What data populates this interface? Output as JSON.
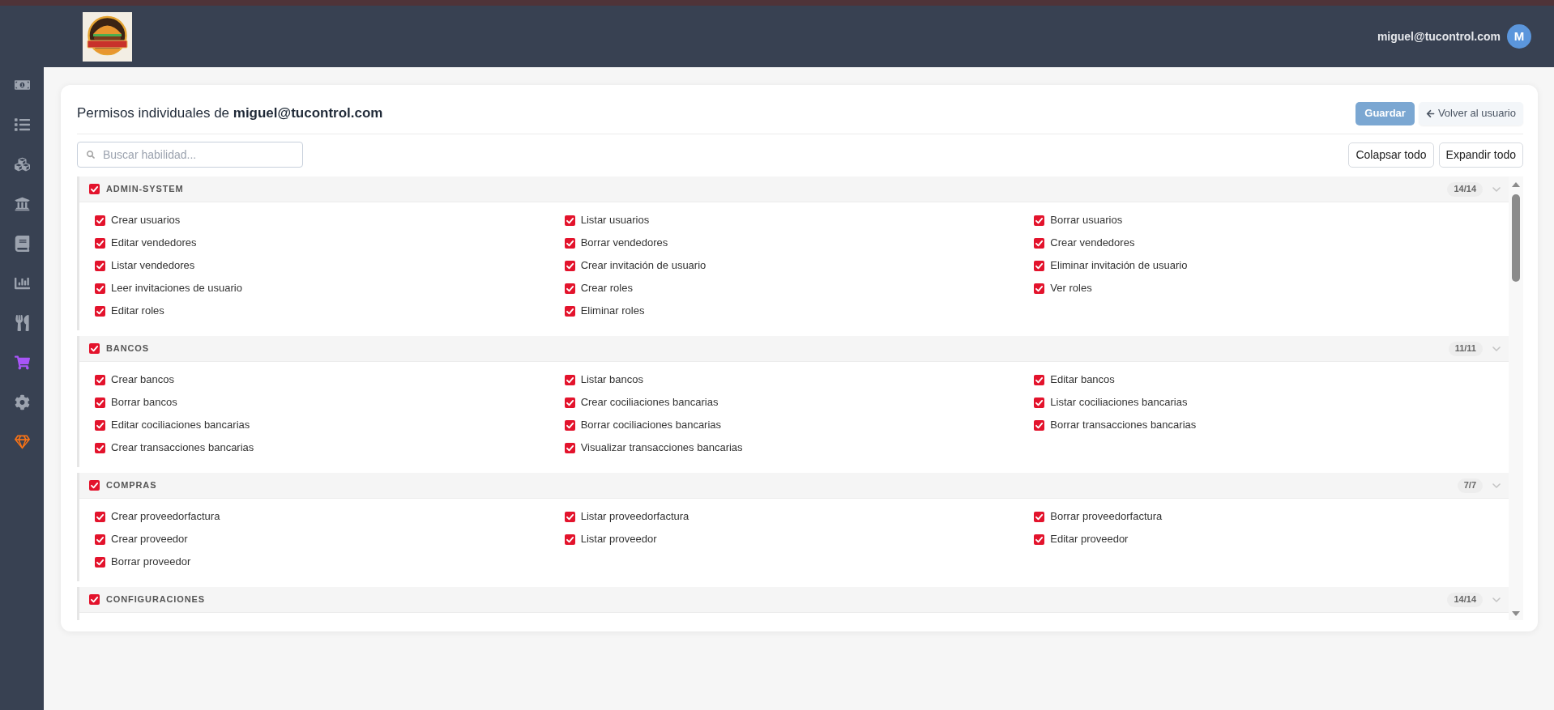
{
  "header": {
    "user": {
      "email": "miguel@tucontrol.com",
      "initial": "M"
    }
  },
  "sidebar": {
    "items": [
      {
        "kind": "nav",
        "selected": false
      },
      {
        "kind": "nav",
        "selected": false
      },
      {
        "kind": "nav",
        "selected": false
      },
      {
        "kind": "nav",
        "selected": false
      },
      {
        "kind": "nav",
        "selected": false
      },
      {
        "kind": "nav",
        "selected": false
      },
      {
        "kind": "nav",
        "selected": false
      },
      {
        "kind": "nav",
        "selected": true
      },
      {
        "kind": "nav",
        "selected": false
      },
      {
        "kind": "upgrade",
        "selected": false
      }
    ]
  },
  "page": {
    "title": "Permisos individuales de **miguel@tucontrol.com**",
    "buttons": [
      {
        "label": "Guardar",
        "kind": "primary",
        "disabled": true
      },
      {
        "label": "Volver al usuario",
        "kind": "back"
      }
    ],
    "search": {
      "placeholder": "Buscar habilidad..."
    },
    "toolbar_buttons": [
      {
        "label": "Colapsar todo"
      },
      {
        "label": "Expandir todo"
      }
    ]
  },
  "sections": [
    {
      "title": "ADMIN-SYSTEM",
      "checked": true,
      "count": "14/14",
      "expanded": true,
      "items": [
        {
          "label": "Crear usuarios",
          "checked": true
        },
        {
          "label": "Listar usuarios",
          "checked": true
        },
        {
          "label": "Borrar usuarios",
          "checked": true
        },
        {
          "label": "Editar vendedores",
          "checked": true
        },
        {
          "label": "Borrar vendedores",
          "checked": true
        },
        {
          "label": "Crear vendedores",
          "checked": true
        },
        {
          "label": "Listar vendedores",
          "checked": true
        },
        {
          "label": "Crear invitación de usuario",
          "checked": true
        },
        {
          "label": "Eliminar invitación de usuario",
          "checked": true
        },
        {
          "label": "Leer invitaciones de usuario",
          "checked": true
        },
        {
          "label": "Crear roles",
          "checked": true
        },
        {
          "label": "Ver roles",
          "checked": true
        },
        {
          "label": "Editar roles",
          "checked": true
        },
        {
          "label": "Eliminar roles",
          "checked": true
        }
      ]
    },
    {
      "title": "BANCOS",
      "checked": true,
      "count": "11/11",
      "expanded": true,
      "items": [
        {
          "label": "Crear bancos",
          "checked": true
        },
        {
          "label": "Listar bancos",
          "checked": true
        },
        {
          "label": "Editar bancos",
          "checked": true
        },
        {
          "label": "Borrar bancos",
          "checked": true
        },
        {
          "label": "Crear cociliaciones bancarias",
          "checked": true
        },
        {
          "label": "Listar cociliaciones bancarias",
          "checked": true
        },
        {
          "label": "Editar cociliaciones bancarias",
          "checked": true
        },
        {
          "label": "Borrar cociliaciones bancarias",
          "checked": true
        },
        {
          "label": "Borrar transacciones bancarias",
          "checked": true
        },
        {
          "label": "Crear transacciones bancarias",
          "checked": true
        },
        {
          "label": "Visualizar transacciones bancarias",
          "checked": true
        }
      ]
    },
    {
      "title": "COMPRAS",
      "checked": true,
      "count": "7/7",
      "expanded": true,
      "items": [
        {
          "label": "Crear proveedorfactura",
          "checked": true
        },
        {
          "label": "Listar proveedorfactura",
          "checked": true
        },
        {
          "label": "Borrar proveedorfactura",
          "checked": true
        },
        {
          "label": "Crear proveedor",
          "checked": true
        },
        {
          "label": "Listar proveedor",
          "checked": true
        },
        {
          "label": "Editar proveedor",
          "checked": true
        },
        {
          "label": "Borrar proveedor",
          "checked": true
        }
      ]
    },
    {
      "title": "CONFIGURACIONES",
      "checked": true,
      "count": "14/14",
      "expanded": true
    }
  ]
}
